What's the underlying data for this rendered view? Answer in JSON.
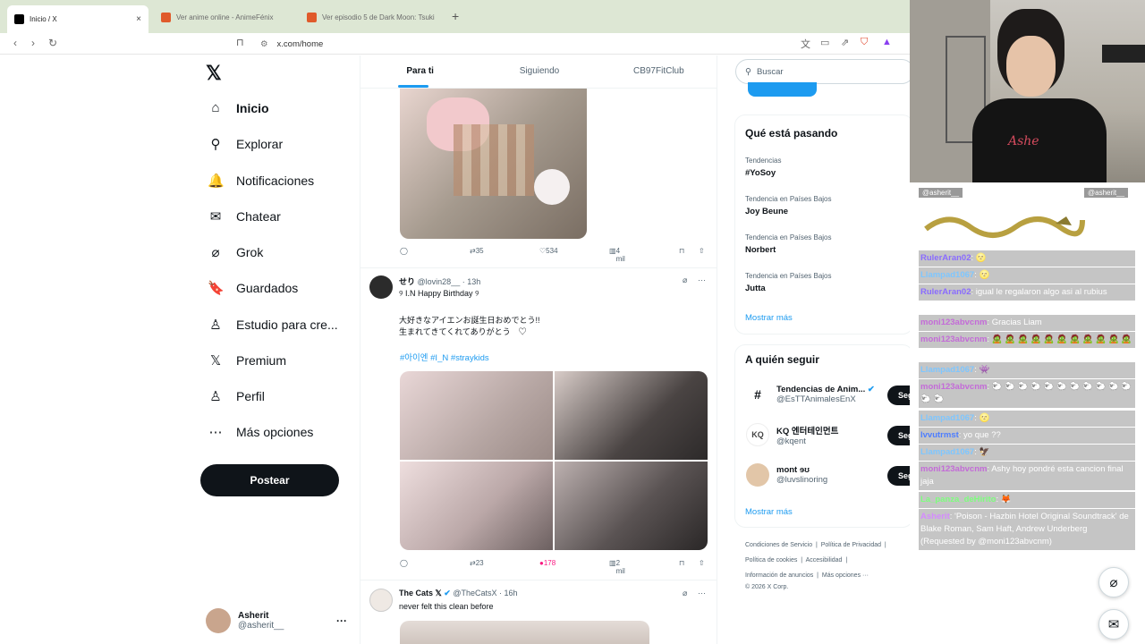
{
  "browser": {
    "tabs": [
      {
        "label": "Inicio / X",
        "active": true
      },
      {
        "label": "Ver anime online - AnimeFénix",
        "active": false
      },
      {
        "label": "Ver episodio 5 de Dark Moon: Tsuki",
        "active": false
      }
    ],
    "url": "x.com/home",
    "close_glyph": "×",
    "newtab_glyph": "+"
  },
  "sidebar": {
    "logo": "𝕏",
    "items": [
      {
        "label": "Inicio",
        "icon": "⌂"
      },
      {
        "label": "Explorar",
        "icon": "⚲"
      },
      {
        "label": "Notificaciones",
        "icon": "🔔"
      },
      {
        "label": "Chatear",
        "icon": "✉"
      },
      {
        "label": "Grok",
        "icon": "⌀"
      },
      {
        "label": "Guardados",
        "icon": "🔖"
      },
      {
        "label": "Estudio para cre...",
        "icon": "♙"
      },
      {
        "label": "Premium",
        "icon": "𝕏"
      },
      {
        "label": "Perfil",
        "icon": "♙"
      },
      {
        "label": "Más opciones",
        "icon": "⋯"
      }
    ],
    "post_label": "Postear",
    "profile": {
      "name": "Asherit",
      "handle": "@asherit__"
    }
  },
  "timeline": {
    "tabs": [
      "Para ti",
      "Siguiendo",
      "CB97FitClub"
    ],
    "post1_actions": {
      "retweets": "35",
      "likes": "534",
      "views": "4 mil"
    },
    "post2": {
      "name": "せり",
      "handle": "@lovin28__",
      "time": "· 13h",
      "line1": "୨ I.N Happy Birthday ୨",
      "line2": "大好きなアイエンお誕生日おめでとう!!",
      "line3": "生まれてきてくれてありがとう　♡",
      "hashtags": "#아이엔 #I_N #straykids",
      "retweets": "23",
      "likes": "178",
      "views": "2 mil"
    },
    "post3": {
      "name": "The Cats 𝕏",
      "handle": "@TheCatsX",
      "time": "· 16h",
      "text": "never felt this clean before"
    }
  },
  "right": {
    "search_placeholder": "Buscar",
    "trends_title": "Qué está pasando",
    "trends": [
      {
        "context": "Tendencias",
        "name": "#YoSoy"
      },
      {
        "context": "Tendencia en Países Bajos",
        "name": "Joy Beune"
      },
      {
        "context": "Tendencia en Países Bajos",
        "name": "Norbert"
      },
      {
        "context": "Tendencia en Países Bajos",
        "name": "Jutta"
      }
    ],
    "show_more": "Mostrar más",
    "follow_title": "A quién seguir",
    "follows": [
      {
        "name": "Tendencias de Anim...",
        "handle": "@EsTTAnimalesEnX",
        "avatar": "#"
      },
      {
        "name": "KQ 엔터테인먼트",
        "handle": "@kqent",
        "avatar": "KQ"
      },
      {
        "name": "mont ɘʊ",
        "handle": "@luvslinoring",
        "avatar": ""
      }
    ],
    "follow_label": "Segui",
    "footer": [
      "Condiciones de Servicio",
      "Política de Privacidad",
      "Política de cookies",
      "Accesibilidad",
      "Información de anuncios",
      "Más opciones ···",
      "© 2026 X Corp."
    ]
  },
  "chat": [
    {
      "user": "RulerAran02",
      "msg": ": 🌝"
    },
    {
      "user": "Llampad1067",
      "msg": ": 🌝"
    },
    {
      "user": "RulerAran02",
      "msg": ": igual le regalaron algo asi al rubius"
    },
    {
      "user": "moni123abvcnm",
      "msg": ": Gracias Liam"
    },
    {
      "user": "moni123abvcnm",
      "msg": ": 🧟 🧟 🧟 🧟 🧟 🧟 🧟 🧟 🧟 🧟 🧟"
    },
    {
      "user": "Llampad1067",
      "msg": ": 👾"
    },
    {
      "user": "moni123abvcnm",
      "msg": ": 🐑 🐑 🐑 🐑 🐑 🐑 🐑 🐑 🐑 🐑 🐑 🐑 🐑"
    },
    {
      "user": "Llampad1067",
      "msg": ": 🌝"
    },
    {
      "user": "lvvutrmst",
      "msg": ": yo que ??"
    },
    {
      "user": "Llampad1067",
      "msg": ": 🦅"
    },
    {
      "user": "moni123abvcnm",
      "msg": ": Ashy hoy pondré esta cancion final jaja"
    },
    {
      "user": "La_panza_deHirito",
      "msg": ": 🦊"
    },
    {
      "user": "Asherit",
      "msg": ": 'Poison - Hazbin Hotel Original Soundtrack' de Blake Roman, Sam Haft, Andrew Underberg (Requested by @moni123abvcnm)"
    }
  ],
  "chat_header_names": [
    "@asherit__",
    "@asherit__"
  ]
}
